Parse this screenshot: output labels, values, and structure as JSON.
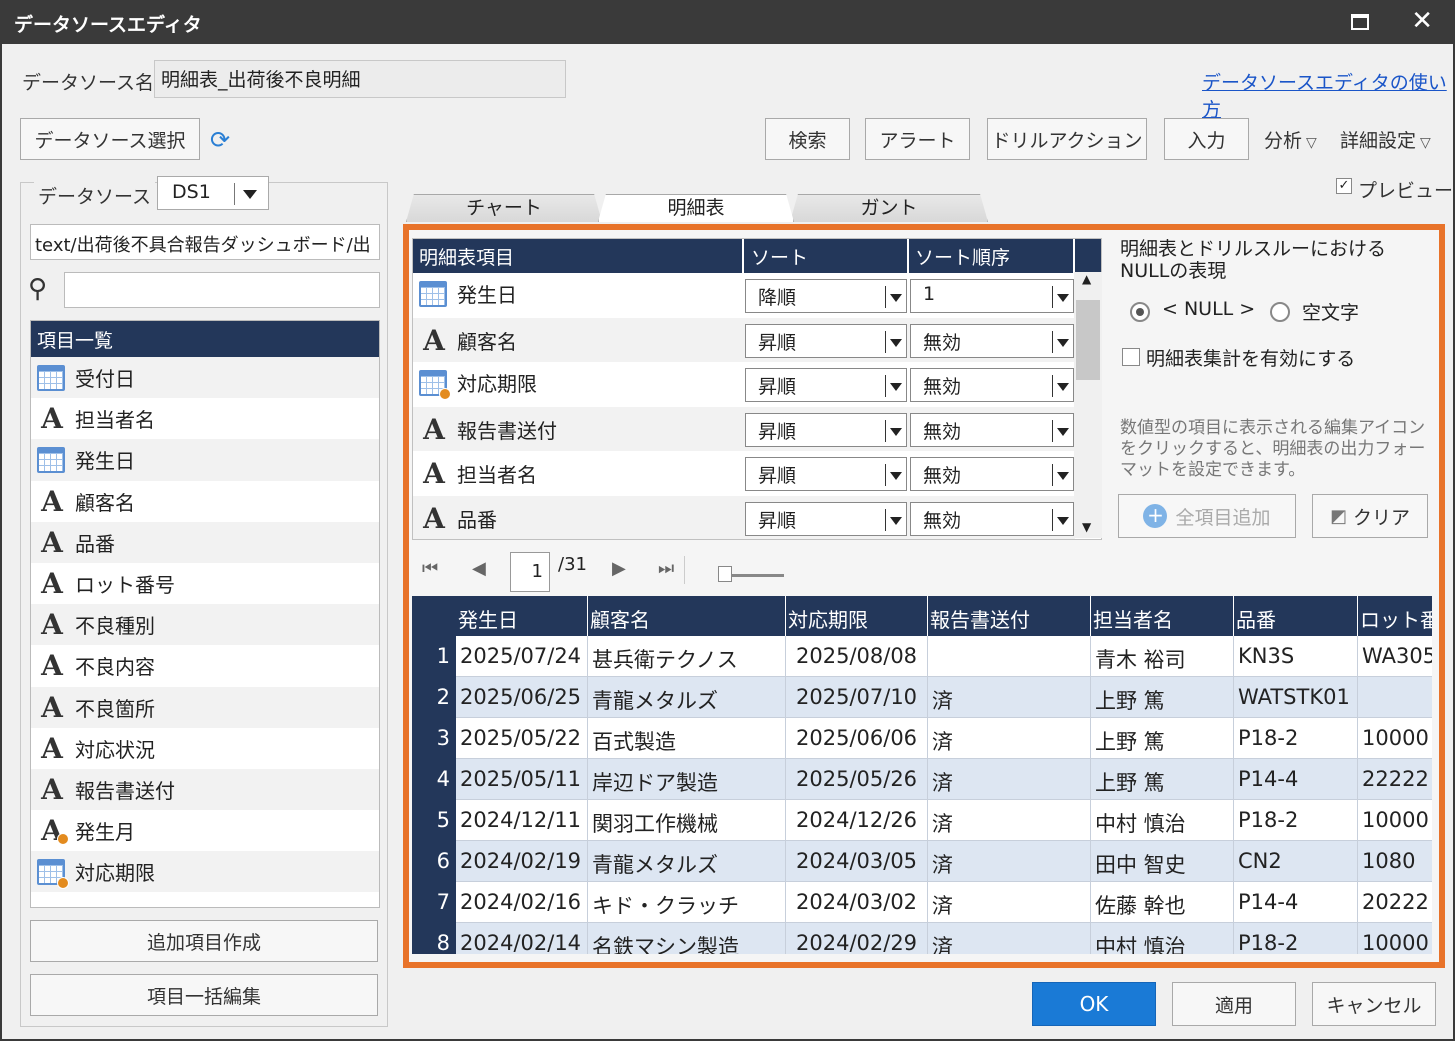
{
  "window": {
    "title": "データソースエディタ"
  },
  "header": {
    "datasource_name_label": "データソース名",
    "datasource_name_value": "明細表_出荷後不良明細",
    "help_link": "データソースエディタの使い方"
  },
  "toolbar": {
    "select_datasource": "データソース選択",
    "search": "検索",
    "alert": "アラート",
    "drill_action": "ドリルアクション",
    "input": "入力",
    "analysis": "分析",
    "advanced": "詳細設定"
  },
  "left": {
    "datasource_label": "データソース",
    "datasource_value": "DS1",
    "path": "text/出荷後不具合報告ダッシュボード/出",
    "list_header": "項目一覧",
    "items": [
      {
        "label": "受付日",
        "icon": "calendar-icon"
      },
      {
        "label": "担当者名",
        "icon": "text-field-icon"
      },
      {
        "label": "発生日",
        "icon": "calendar-icon"
      },
      {
        "label": "顧客名",
        "icon": "text-field-icon"
      },
      {
        "label": "品番",
        "icon": "text-field-icon"
      },
      {
        "label": "ロット番号",
        "icon": "text-field-icon"
      },
      {
        "label": "不良種別",
        "icon": "text-field-icon"
      },
      {
        "label": "不良内容",
        "icon": "text-field-icon"
      },
      {
        "label": "不良箇所",
        "icon": "text-field-icon"
      },
      {
        "label": "対応状況",
        "icon": "text-field-icon"
      },
      {
        "label": "報告書送付",
        "icon": "text-field-icon"
      },
      {
        "label": "発生月",
        "icon": "calc-text-field-icon"
      },
      {
        "label": "対応期限",
        "icon": "calc-calendar-icon"
      }
    ],
    "add_item_button": "追加項目作成",
    "bulk_edit_button": "項目一括編集"
  },
  "tabs": {
    "chart": "チャート",
    "detail": "明細表",
    "gantt": "ガント",
    "preview": "プレビュー"
  },
  "detail_grid": {
    "headers": [
      "明細表項目",
      "ソート",
      "ソート順序"
    ],
    "rows": [
      {
        "name": "発生日",
        "icon": "calendar-icon",
        "sort": "降順",
        "order": "1"
      },
      {
        "name": "顧客名",
        "icon": "text-field-icon",
        "sort": "昇順",
        "order": "無効"
      },
      {
        "name": "対応期限",
        "icon": "calc-calendar-icon",
        "sort": "昇順",
        "order": "無効"
      },
      {
        "name": "報告書送付",
        "icon": "text-field-icon",
        "sort": "昇順",
        "order": "無効"
      },
      {
        "name": "担当者名",
        "icon": "text-field-icon",
        "sort": "昇順",
        "order": "無効"
      },
      {
        "name": "品番",
        "icon": "text-field-icon",
        "sort": "昇順",
        "order": "無効"
      }
    ]
  },
  "null_panel": {
    "title": "明細表とドリルスルーにおけるNULLの表現",
    "opt_null": "< NULL >",
    "opt_empty": "空文字",
    "enable_total": "明細表集計を有効にする",
    "hint": "数値型の項目に表示される編集アイコンをクリックすると、明細表の出力フォーマットを設定できます。",
    "add_all": "全項目追加",
    "clear": "クリア"
  },
  "pager": {
    "page": "1",
    "total": "/31"
  },
  "result": {
    "headers": [
      "発生日",
      "顧客名",
      "対応期限",
      "報告書送付",
      "担当者名",
      "品番",
      "ロット番"
    ],
    "rows": [
      [
        "1",
        "2025/07/24",
        "甚兵衛テクノス",
        "2025/08/08",
        "",
        "青木 裕司",
        "KN3S",
        "WA305"
      ],
      [
        "2",
        "2025/06/25",
        "青龍メタルズ",
        "2025/07/10",
        "済",
        "上野 篤",
        "WATSTK01",
        ""
      ],
      [
        "3",
        "2025/05/22",
        "百式製造",
        "2025/06/06",
        "済",
        "上野 篤",
        "P18-2",
        "10000"
      ],
      [
        "4",
        "2025/05/11",
        "岸辺ドア製造",
        "2025/05/26",
        "済",
        "上野 篤",
        "P14-4",
        "22222"
      ],
      [
        "5",
        "2024/12/11",
        "関羽工作機械",
        "2024/12/26",
        "済",
        "中村 慎治",
        "P18-2",
        "10000"
      ],
      [
        "6",
        "2024/02/19",
        "青龍メタルズ",
        "2024/03/05",
        "済",
        "田中 智史",
        "CN2",
        "1080"
      ],
      [
        "7",
        "2024/02/16",
        "キド・クラッチ",
        "2024/03/02",
        "済",
        "佐藤 幹也",
        "P14-4",
        "20222"
      ],
      [
        "8",
        "2024/02/14",
        "名鉄マシン製造",
        "2024/02/29",
        "済",
        "中村 慎治",
        "P18-2",
        "10000"
      ]
    ]
  },
  "footer": {
    "ok": "OK",
    "apply": "適用",
    "cancel": "キャンセル"
  },
  "colors": {
    "accent": "#1a7ad6",
    "header": "#23375a",
    "highlight_frame": "#e8732a"
  }
}
